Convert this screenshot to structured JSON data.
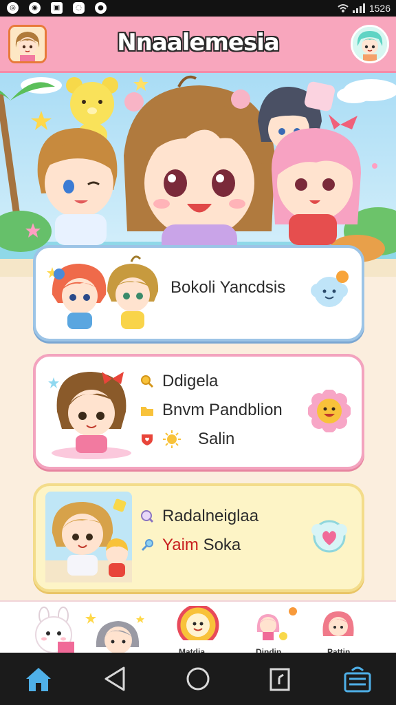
{
  "status_bar": {
    "left_icons": [
      "camera-icon",
      "photo-icon",
      "message-icon",
      "app-icon",
      "notification-icon"
    ],
    "time": "1526"
  },
  "header": {
    "title": "Nnaalemesia"
  },
  "cards": [
    {
      "label": "Bokoli Yancdsis"
    },
    {
      "rows": [
        "Ddigela",
        "Bnvm Pandblion",
        "Salin"
      ]
    },
    {
      "rows": [
        "Radalneiglaa",
        "Yaim Soka"
      ]
    }
  ],
  "bottom_nav": {
    "labels": [
      "Matdia",
      "Dindin",
      "Pattin"
    ]
  },
  "colors": {
    "header_bg": "#f8a6bd",
    "card1_border": "#9cc4e6",
    "card2_border": "#f3a3be",
    "card3_border": "#f3dc8a",
    "highlight_text": "#c81e1e"
  }
}
